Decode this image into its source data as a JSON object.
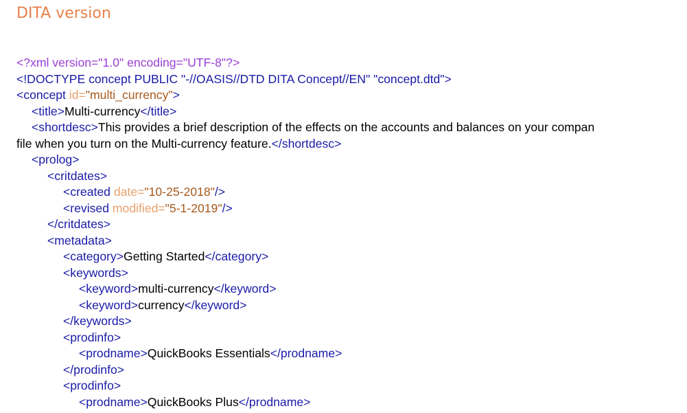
{
  "heading": "DITA version",
  "colors": {
    "heading": "#e8804a",
    "pi": "#9b3fd6",
    "tag": "#1a1aa8",
    "attr": "#e8a06c",
    "value": "#a65a1e",
    "text": "#000000"
  },
  "code_lines": [
    {
      "indent": 0,
      "tokens": [
        {
          "type": "pi",
          "text": "<?xml version=\"1.0\" encoding=\"UTF-8\"?>"
        }
      ]
    },
    {
      "indent": 0,
      "tokens": [
        {
          "type": "tag",
          "text": "<!DOCTYPE concept PUBLIC \"-//OASIS//DTD DITA Concept//EN\" \"concept.dtd\">"
        }
      ]
    },
    {
      "indent": 0,
      "tokens": [
        {
          "type": "tag",
          "text": "<concept "
        },
        {
          "type": "attr",
          "text": "id="
        },
        {
          "type": "value",
          "text": "\"multi_currency\""
        },
        {
          "type": "tag",
          "text": ">"
        }
      ]
    },
    {
      "indent": 1,
      "tokens": [
        {
          "type": "tag",
          "text": "<title>"
        },
        {
          "type": "text",
          "text": "Multi-currency"
        },
        {
          "type": "tag",
          "text": "</title>"
        }
      ]
    },
    {
      "indent": 1,
      "tokens": [
        {
          "type": "tag",
          "text": "<shortdesc>"
        },
        {
          "type": "text",
          "text": "This provides a brief description of the effects on the accounts and balances on your compan"
        }
      ]
    },
    {
      "indent": 0,
      "tokens": [
        {
          "type": "text",
          "text": "file when you turn on the Multi-currency feature."
        },
        {
          "type": "tag",
          "text": "</shortdesc>"
        }
      ]
    },
    {
      "indent": 1,
      "tokens": [
        {
          "type": "tag",
          "text": "<prolog>"
        }
      ]
    },
    {
      "indent": 2,
      "tokens": [
        {
          "type": "tag",
          "text": "<critdates>"
        }
      ]
    },
    {
      "indent": 3,
      "tokens": [
        {
          "type": "tag",
          "text": "<created "
        },
        {
          "type": "attr",
          "text": "date="
        },
        {
          "type": "value",
          "text": "\"10-25-2018\""
        },
        {
          "type": "tag",
          "text": "/>"
        }
      ]
    },
    {
      "indent": 3,
      "tokens": [
        {
          "type": "tag",
          "text": "<revised "
        },
        {
          "type": "attr",
          "text": "modified="
        },
        {
          "type": "value",
          "text": "\"5-1-2019\""
        },
        {
          "type": "tag",
          "text": "/>"
        }
      ]
    },
    {
      "indent": 2,
      "tokens": [
        {
          "type": "tag",
          "text": "</critdates>"
        }
      ]
    },
    {
      "indent": 2,
      "tokens": [
        {
          "type": "tag",
          "text": "<metadata>"
        }
      ]
    },
    {
      "indent": 3,
      "tokens": [
        {
          "type": "tag",
          "text": "<category>"
        },
        {
          "type": "text",
          "text": "Getting Started"
        },
        {
          "type": "tag",
          "text": "</category>"
        }
      ]
    },
    {
      "indent": 3,
      "tokens": [
        {
          "type": "tag",
          "text": "<keywords>"
        }
      ]
    },
    {
      "indent": 4,
      "tokens": [
        {
          "type": "tag",
          "text": "<keyword>"
        },
        {
          "type": "text",
          "text": "multi-currency"
        },
        {
          "type": "tag",
          "text": "</keyword>"
        }
      ]
    },
    {
      "indent": 4,
      "tokens": [
        {
          "type": "tag",
          "text": "<keyword>"
        },
        {
          "type": "text",
          "text": "currency"
        },
        {
          "type": "tag",
          "text": "</keyword>"
        }
      ]
    },
    {
      "indent": 3,
      "tokens": [
        {
          "type": "tag",
          "text": "</keywords>"
        }
      ]
    },
    {
      "indent": 3,
      "tokens": [
        {
          "type": "tag",
          "text": "<prodinfo>"
        }
      ]
    },
    {
      "indent": 4,
      "tokens": [
        {
          "type": "tag",
          "text": "<prodname>"
        },
        {
          "type": "text",
          "text": "QuickBooks Essentials"
        },
        {
          "type": "tag",
          "text": "</prodname>"
        }
      ]
    },
    {
      "indent": 3,
      "tokens": [
        {
          "type": "tag",
          "text": "</prodinfo>"
        }
      ]
    },
    {
      "indent": 3,
      "tokens": [
        {
          "type": "tag",
          "text": "<prodinfo>"
        }
      ]
    },
    {
      "indent": 4,
      "tokens": [
        {
          "type": "tag",
          "text": "<prodname>"
        },
        {
          "type": "text",
          "text": "QuickBooks Plus"
        },
        {
          "type": "tag",
          "text": "</prodname>"
        }
      ]
    }
  ]
}
